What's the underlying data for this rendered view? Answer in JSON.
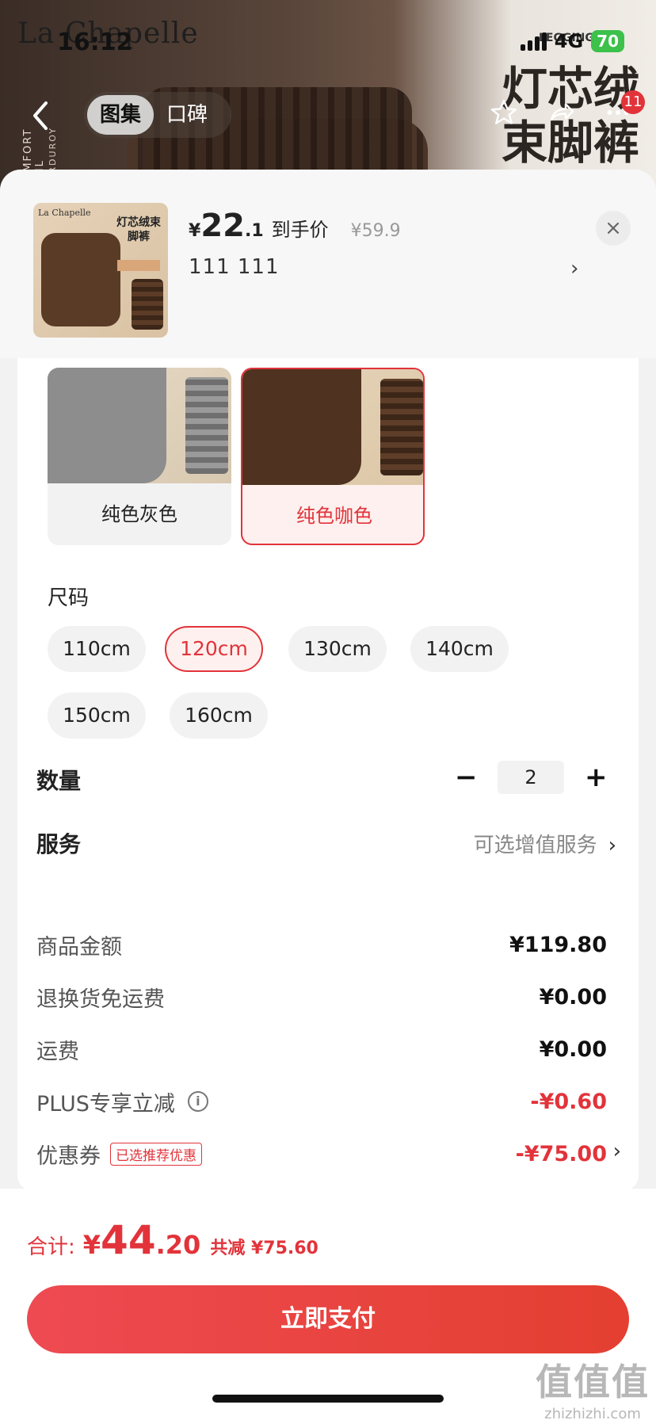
{
  "status_bar": {
    "time": "16:12",
    "network": "4G",
    "battery": "70"
  },
  "hero": {
    "brand": "La Chapelle",
    "side_text": "COMFORT QUIL",
    "side_text2": "CORDUROY",
    "badge_text": "LEGGING",
    "title_line1": "灯芯绒",
    "title_line2": "束脚裤"
  },
  "nav": {
    "tabs": [
      "图集",
      "口碑"
    ],
    "cart_badge": "11"
  },
  "summary": {
    "thumb_brand": "La Chapelle",
    "thumb_title": "灯芯绒束脚裤",
    "price_yen": "¥",
    "price_int": "22",
    "price_dec": ".1",
    "price_label": "到手价",
    "original_price": "¥59.9",
    "selected_spec": "111  111",
    "chevron": "›",
    "close": "×"
  },
  "colors": [
    {
      "label": "纯色灰色",
      "selected": false
    },
    {
      "label": "纯色咖色",
      "selected": true
    }
  ],
  "size": {
    "title": "尺码",
    "options": [
      "110cm",
      "120cm",
      "130cm",
      "140cm",
      "150cm",
      "160cm"
    ],
    "selected": "120cm"
  },
  "quantity": {
    "label": "数量",
    "minus": "−",
    "value": "2",
    "plus": "+"
  },
  "service": {
    "label": "服务",
    "value": "可选增值服务",
    "chevron": "›"
  },
  "price_breakdown": {
    "rows": [
      {
        "label": "商品金额",
        "value": "¥119.80"
      },
      {
        "label": "退换货免运费",
        "value": "¥0.00"
      },
      {
        "label": "运费",
        "value": "¥0.00"
      },
      {
        "label": "PLUS专享立减",
        "value": "-¥0.60"
      },
      {
        "label": "优惠券",
        "tag": "已选推荐优惠",
        "value": "-¥75.00"
      }
    ]
  },
  "footer": {
    "total_label": "合计:",
    "total_yen": "¥",
    "total_int": "44",
    "total_dec": ".20",
    "saved": "共减 ¥75.60",
    "pay_button": "立即支付"
  },
  "watermark": {
    "line1": "值值值",
    "line2": "zhizhizhi.com"
  },
  "colors_theme": {
    "accent": "#e2333a",
    "card": "#ffffff",
    "page_bg": "#f2f2f2"
  }
}
